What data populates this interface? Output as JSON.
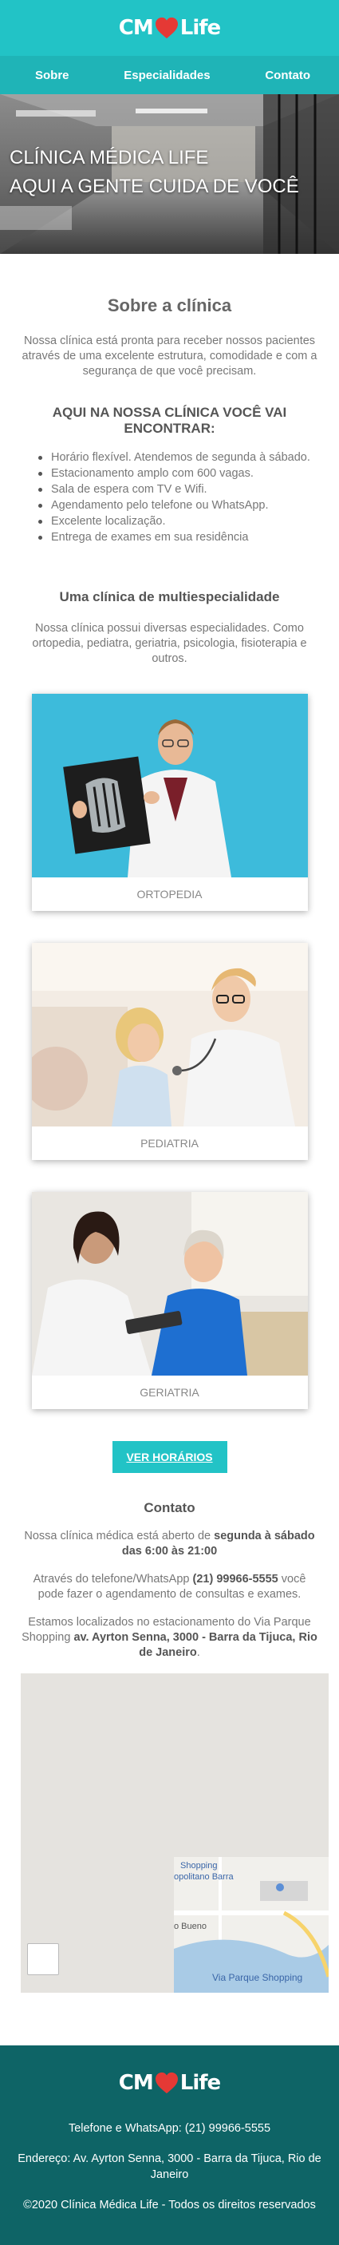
{
  "brand": {
    "logo_left": "CM",
    "logo_right": "Life"
  },
  "nav": {
    "items": [
      "Sobre",
      "Especialidades",
      "Contato"
    ]
  },
  "hero": {
    "line1": "CLÍNICA MÉDICA LIFE",
    "line2": "AQUI A GENTE CUIDA DE VOCÊ"
  },
  "about": {
    "title": "Sobre a clínica",
    "text": "Nossa clínica está pronta para receber nossos pacientes através de uma excelente estrutura, comodidade e com a segurança de que você precisam.",
    "find_title": "AQUI NA NOSSA CLÍNICA VOCÊ VAI ENCONTRAR:",
    "features": [
      "Horário flexível. Atendemos de segunda à sábado.",
      "Estacionamento amplo com 600 vagas.",
      "Sala de espera com TV e Wifi.",
      "Agendamento pelo telefone ou WhatsApp.",
      "Excelente localização.",
      "Entrega de exames em sua residência"
    ]
  },
  "specialties": {
    "title": "Uma clínica de multiespecialidade",
    "text": "Nossa clínica possui diversas especialidades. Como ortopedia, pediatra, geriatria, psicologia, fisioterapia e outros.",
    "cards": [
      "ORTOPEDIA",
      "PEDIATRIA",
      "GERIATRIA"
    ]
  },
  "hours_button": "VER HORÁRIOS",
  "contact": {
    "title": "Contato",
    "p1_a": "Nossa clínica médica está aberto de ",
    "p1_b": "segunda à sábado das 6:00 às 21:00",
    "p2_a": "Através do telefone/WhatsApp ",
    "p2_b": "(21) 99966-5555",
    "p2_c": " você pode fazer o agendamento de consultas e exames.",
    "p3_a": "Estamos localizados no estacionamento do Via Parque Shopping ",
    "p3_b": "av. Ayrton Senna, 3000 - Barra da Tijuca, Rio de Janeiro",
    "p3_c": "."
  },
  "map": {
    "labels": [
      "Shopping",
      "opolitano Barra",
      "o Bueno",
      "Via Parque Shopping"
    ]
  },
  "footer": {
    "phone": "Telefone e WhatsApp: (21) 99966-5555",
    "address": "Endereço: Av. Ayrton Senna, 3000 - Barra da Tijuca, Rio de Janeiro",
    "copyright": "©2020 Clínica Médica Life - Todos os direitos reservados"
  },
  "colors": {
    "accent": "#22c3c6",
    "nav": "#1fb4b7",
    "heart": "#e53935",
    "footer": "#0e6466"
  }
}
